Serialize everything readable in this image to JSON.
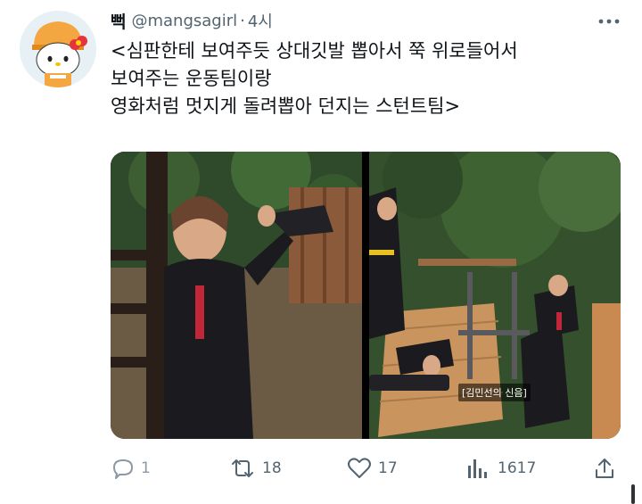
{
  "tweet": {
    "display_name": "뻑",
    "handle": "@mangsagirl",
    "separator": "·",
    "time": "4시",
    "lines": [
      "<심판한테 보여주듯 상대깃발 뽑아서 쭉 위로들어서",
      "보여주는 운동팀이랑",
      "영화처럼 멋지게 돌려뽑아 던지는 스턴트팀>"
    ],
    "caption": "[김민선의 신음]"
  },
  "actions": {
    "reply_count": "1",
    "retweet_count": "18",
    "like_count": "17",
    "view_count": "1617"
  },
  "icons": {
    "more": "more-horizontal-icon",
    "reply": "reply-icon",
    "retweet": "retweet-icon",
    "like": "heart-icon",
    "views": "bar-chart-icon",
    "share": "share-icon"
  },
  "colors": {
    "text": "#0f1419",
    "secondary": "#536471",
    "background": "#ffffff"
  }
}
